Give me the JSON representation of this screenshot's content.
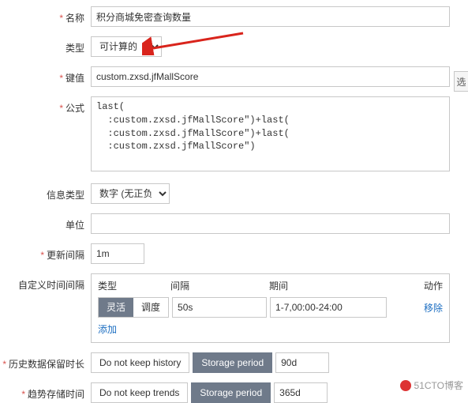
{
  "labels": {
    "name": "名称",
    "type": "类型",
    "key": "键值",
    "formula": "公式",
    "infoType": "信息类型",
    "unit": "单位",
    "updateInterval": "更新间隔",
    "customInterval": "自定义时间间隔",
    "historyKeep": "历史数据保留时长",
    "trendStore": "趋势存储时间"
  },
  "values": {
    "name": "积分商城免密查询数量",
    "type": "可计算的",
    "key": "custom.zxsd.jfMallScore",
    "formula": "last(\n  :custom.zxsd.jfMallScore\")+last(\n  :custom.zxsd.jfMallScore\")+last(\n  :custom.zxsd.jfMallScore\")",
    "infoType": "数字 (无正负)",
    "unit": "",
    "updateInterval": "1m",
    "historyPeriod": "90d",
    "trendPeriod": "365d"
  },
  "interval": {
    "headers": {
      "type": "类型",
      "interval": "间隔",
      "period": "期间",
      "action": "动作"
    },
    "seg": {
      "flex": "灵活",
      "schedule": "调度"
    },
    "intervalVal": "50s",
    "periodVal": "1-7,00:00-24:00",
    "remove": "移除",
    "add": "添加"
  },
  "buttons": {
    "noHistory": "Do not keep history",
    "storagePeriod": "Storage period",
    "noTrends": "Do not keep trends"
  },
  "sideBtn": "选",
  "watermark": "51CTO博客"
}
